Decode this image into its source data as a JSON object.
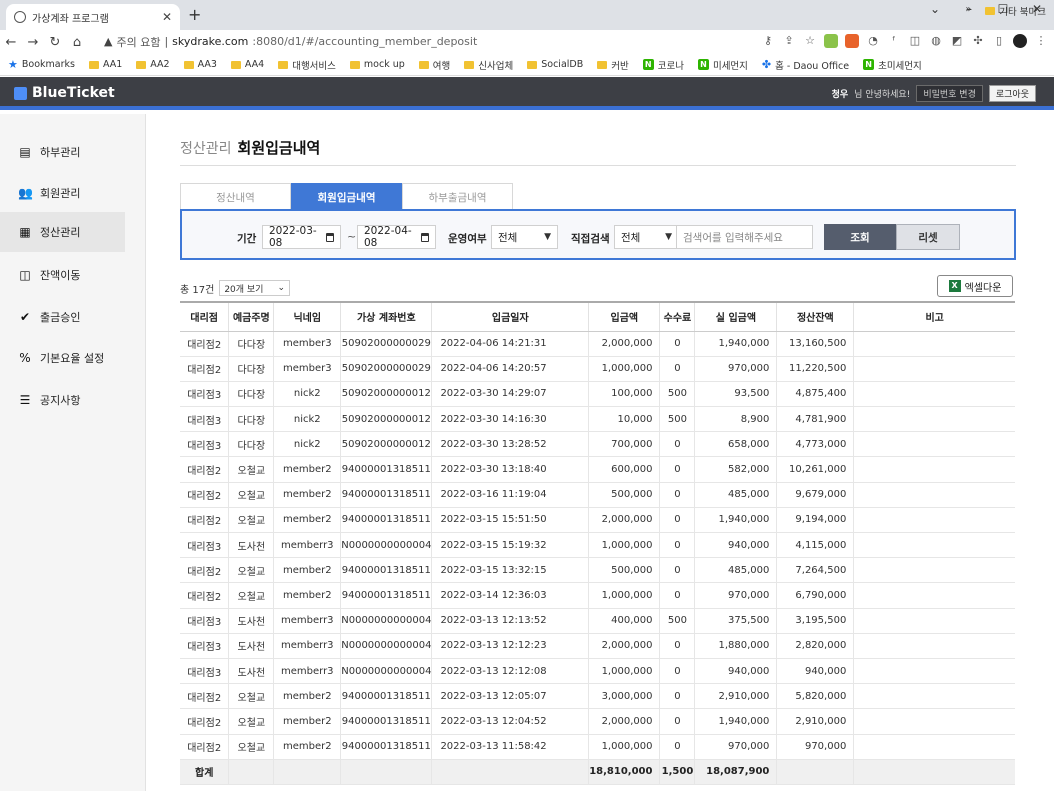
{
  "browser": {
    "tab_title": "가상계좌 프로그램",
    "close_symbol": "✕",
    "new_tab_symbol": "+",
    "security_label": "주의 요함",
    "url_host": "skydrake.com",
    "url_path": ":8080/d1/#/accounting_member_deposit",
    "bookmarks": [
      "Bookmarks",
      "AA1",
      "AA2",
      "AA3",
      "AA4",
      "대행서비스",
      "mock up",
      "여행",
      "신사업체",
      "SocialDB",
      "커반",
      "코로나",
      "미세먼지",
      "홈 - Daou Office",
      "초미세먼지"
    ],
    "bookmarks_more": "»",
    "other_bookmarks": "기타 북마크"
  },
  "app": {
    "logo": "BlueTicket",
    "user_name": "청우",
    "greeting": "님 안녕하세요!",
    "change_password": "비밀번호 변경",
    "logout": "로그아웃"
  },
  "sidebar": {
    "items": [
      {
        "label": "하부관리",
        "icon": "org-icon"
      },
      {
        "label": "회원관리",
        "icon": "users-icon"
      },
      {
        "label": "정산관리",
        "icon": "calculator-icon"
      },
      {
        "label": "잔액이동",
        "icon": "transfer-icon"
      },
      {
        "label": "출금승인",
        "icon": "badge-check-icon"
      },
      {
        "label": "기본요율 설정",
        "icon": "percent-icon"
      },
      {
        "label": "공지사항",
        "icon": "list-icon"
      }
    ]
  },
  "page": {
    "parent": "정산관리",
    "title": "회원입금내역",
    "tabs": [
      "정산내역",
      "회원입금내역",
      "하부출금내역"
    ],
    "active_tab": 1
  },
  "filter": {
    "period_label": "기간",
    "date_from": "2022-03-08",
    "tilde": "~",
    "date_to": "2022-04-08",
    "status_label": "운영여부",
    "status_value": "전체",
    "direct_label": "직접검색",
    "direct_value": "전체",
    "search_placeholder": "검색어를 입력해주세요",
    "search_button": "조회",
    "reset_button": "리셋"
  },
  "list": {
    "total": "총 17건",
    "per_page": "20개 보기",
    "excel_button": "엑셀다운"
  },
  "table": {
    "headers": [
      "대리점",
      "예금주명",
      "닉네임",
      "가상 계좌번호",
      "입금일자",
      "입금액",
      "수수료",
      "실 입금액",
      "정산잔액",
      "비고"
    ],
    "rows": [
      [
        "대리점2",
        "다다장",
        "member3",
        "50902000000029",
        "2022-04-06 14:21:31",
        "2,000,000",
        "0",
        "1,940,000",
        "13,160,500",
        ""
      ],
      [
        "대리점2",
        "다다장",
        "member3",
        "50902000000029",
        "2022-04-06 14:20:57",
        "1,000,000",
        "0",
        "970,000",
        "11,220,500",
        ""
      ],
      [
        "대리점3",
        "다다장",
        "nick2",
        "50902000000012",
        "2022-03-30 14:29:07",
        "100,000",
        "500",
        "93,500",
        "4,875,400",
        ""
      ],
      [
        "대리점3",
        "다다장",
        "nick2",
        "50902000000012",
        "2022-03-30 14:16:30",
        "10,000",
        "500",
        "8,900",
        "4,781,900",
        ""
      ],
      [
        "대리점3",
        "다다장",
        "nick2",
        "50902000000012",
        "2022-03-30 13:28:52",
        "700,000",
        "0",
        "658,000",
        "4,773,000",
        ""
      ],
      [
        "대리점2",
        "오철교",
        "member2",
        "94000001318511",
        "2022-03-30 13:18:40",
        "600,000",
        "0",
        "582,000",
        "10,261,000",
        ""
      ],
      [
        "대리점2",
        "오철교",
        "member2",
        "94000001318511",
        "2022-03-16 11:19:04",
        "500,000",
        "0",
        "485,000",
        "9,679,000",
        ""
      ],
      [
        "대리점2",
        "오철교",
        "member2",
        "94000001318511",
        "2022-03-15 15:51:50",
        "2,000,000",
        "0",
        "1,940,000",
        "9,194,000",
        ""
      ],
      [
        "대리점3",
        "도사천",
        "memberr3",
        "N0000000000004",
        "2022-03-15 15:19:32",
        "1,000,000",
        "0",
        "940,000",
        "4,115,000",
        ""
      ],
      [
        "대리점2",
        "오철교",
        "member2",
        "94000001318511",
        "2022-03-15 13:32:15",
        "500,000",
        "0",
        "485,000",
        "7,264,500",
        ""
      ],
      [
        "대리점2",
        "오철교",
        "member2",
        "94000001318511",
        "2022-03-14 12:36:03",
        "1,000,000",
        "0",
        "970,000",
        "6,790,000",
        ""
      ],
      [
        "대리점3",
        "도사천",
        "memberr3",
        "N0000000000004",
        "2022-03-13 12:13:52",
        "400,000",
        "500",
        "375,500",
        "3,195,500",
        ""
      ],
      [
        "대리점3",
        "도사천",
        "memberr3",
        "N0000000000004",
        "2022-03-13 12:12:23",
        "2,000,000",
        "0",
        "1,880,000",
        "2,820,000",
        ""
      ],
      [
        "대리점3",
        "도사천",
        "memberr3",
        "N0000000000004",
        "2022-03-13 12:12:08",
        "1,000,000",
        "0",
        "940,000",
        "940,000",
        ""
      ],
      [
        "대리점2",
        "오철교",
        "member2",
        "94000001318511",
        "2022-03-13 12:05:07",
        "3,000,000",
        "0",
        "2,910,000",
        "5,820,000",
        ""
      ],
      [
        "대리점2",
        "오철교",
        "member2",
        "94000001318511",
        "2022-03-13 12:04:52",
        "2,000,000",
        "0",
        "1,940,000",
        "2,910,000",
        ""
      ],
      [
        "대리점2",
        "오철교",
        "member2",
        "94000001318511",
        "2022-03-13 11:58:42",
        "1,000,000",
        "0",
        "970,000",
        "970,000",
        ""
      ]
    ],
    "summary": [
      "합계",
      "",
      "",
      "",
      "",
      "18,810,000",
      "1,500",
      "18,087,900",
      "",
      ""
    ]
  },
  "colors": {
    "accent": "#3f78d6",
    "header_bg": "#3d3f45",
    "search_button": "#555d6d"
  }
}
